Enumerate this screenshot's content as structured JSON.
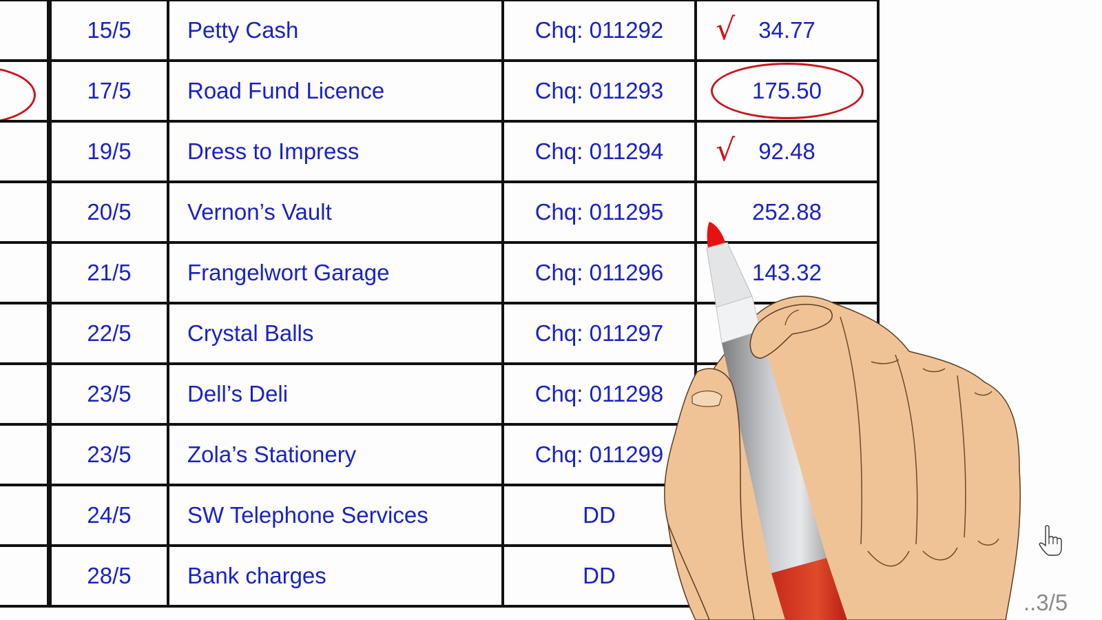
{
  "ledger": {
    "rows": [
      {
        "date": "15/5",
        "payee": "Petty Cash",
        "ref": "Chq: 011292",
        "amount": "34.77",
        "mark": "tick"
      },
      {
        "date": "17/5",
        "payee": "Road Fund Licence",
        "ref": "Chq: 011293",
        "amount": "175.50",
        "mark": "circled"
      },
      {
        "date": "19/5",
        "payee": "Dress to Impress",
        "ref": "Chq: 011294",
        "amount": "92.48",
        "mark": "tick"
      },
      {
        "date": "20/5",
        "payee": "Vernon’s Vault",
        "ref": "Chq: 011295",
        "amount": "252.88",
        "mark": ""
      },
      {
        "date": "21/5",
        "payee": "Frangelwort Garage",
        "ref": "Chq: 011296",
        "amount": "143.32",
        "mark": ""
      },
      {
        "date": "22/5",
        "payee": "Crystal Balls",
        "ref": "Chq: 011297",
        "amount": "",
        "mark": ""
      },
      {
        "date": "23/5",
        "payee": "Dell’s Deli",
        "ref": "Chq: 011298",
        "amount": "",
        "mark": ""
      },
      {
        "date": "23/5",
        "payee": "Zola’s Stationery",
        "ref": "Chq: 011299",
        "amount": "",
        "mark": ""
      },
      {
        "date": "24/5",
        "payee": "SW Telephone Services",
        "ref": "DD",
        "amount": "",
        "mark": ""
      },
      {
        "date": "28/5",
        "payee": "Bank charges",
        "ref": "DD",
        "amount": "",
        "mark": ""
      }
    ],
    "tick_glyph": "√"
  },
  "colors": {
    "text": "#1a22c2",
    "annotation": "#c8141e",
    "grid": "#111111",
    "skin": "#f0c396"
  },
  "icons": {
    "hand_with_marker": "hand-holding-marker-icon",
    "cursor": "pointer-hand-cursor-icon"
  },
  "page_indicator": "..3/5"
}
